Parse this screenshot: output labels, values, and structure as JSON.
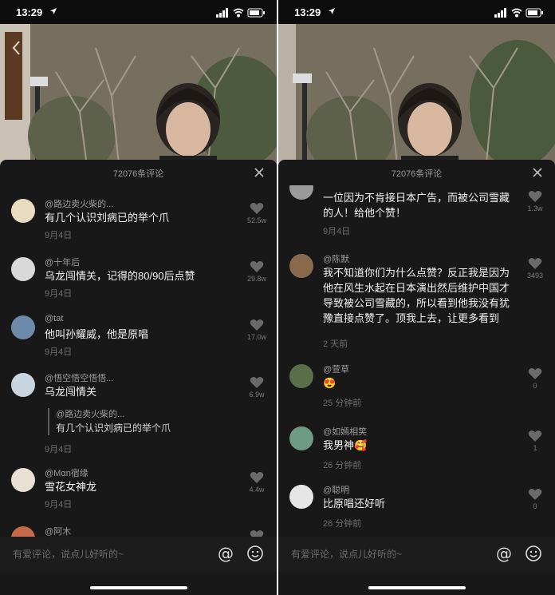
{
  "status_time": "13:29",
  "left": {
    "title": "72076条评论",
    "comments": [
      {
        "user": "@路边卖火柴的...",
        "text": "有几个认识刘病已的举个爪",
        "time": "9月4日",
        "likes": "52.5w"
      },
      {
        "user": "@十年后",
        "text": "乌龙闯情关，记得的80/90后点赞",
        "time": "9月4日",
        "likes": "29.8w"
      },
      {
        "user": "@tat",
        "text": "他叫孙耀威，他是原唱",
        "time": "9月4日",
        "likes": "17.0w"
      },
      {
        "user": "@悟空悟空悟悟...",
        "text": "乌龙闯情关",
        "time": "9月4日",
        "likes": "6.9w",
        "reply_user": "@路边卖火柴的...",
        "reply_text": "有几个认识刘病已的举个爪"
      },
      {
        "user": "@Mαn宿缘",
        "text": "雪花女神龙",
        "time": "9月4日",
        "likes": "4.4w"
      },
      {
        "user": "@阿木",
        "text": "",
        "time": "",
        "likes": ""
      }
    ],
    "input_placeholder": "有爱评论，说点儿好听的~"
  },
  "right": {
    "title": "72076条评论",
    "comments": [
      {
        "user": "",
        "text": "一位因为不肯接日本广告，而被公司雪藏的人！给他个赞！",
        "time": "9月4日",
        "likes": "1.3w"
      },
      {
        "user": "@陈默",
        "text": "我不知道你们为什么点赞？反正我是因为他在风生水起在日本演出然后维护中国才导致被公司雪藏的，所以看到他我没有犹豫直接点赞了。顶我上去，让更多看到",
        "time": "2 天前",
        "likes": "3493"
      },
      {
        "user": "@萱草",
        "text": "😍",
        "time": "25 分钟前",
        "likes": "0"
      },
      {
        "user": "@如嫣相笑",
        "text": "我男神🥰",
        "time": "26 分钟前",
        "likes": "1"
      },
      {
        "user": "@聪明",
        "text": "比原唱还好听",
        "time": "26 分钟前",
        "likes": "0"
      }
    ],
    "input_placeholder": "有爱评论，说点儿好听的~"
  },
  "icons": [
    "location-arrow-icon",
    "signal-icon",
    "wifi-icon",
    "battery-icon",
    "back-icon",
    "close-icon",
    "heart-icon",
    "at-icon",
    "emoji-icon"
  ],
  "colors": {
    "sheet_bg": "#181818",
    "text": "#f2f2f2",
    "muted": "#9b9b9b"
  }
}
